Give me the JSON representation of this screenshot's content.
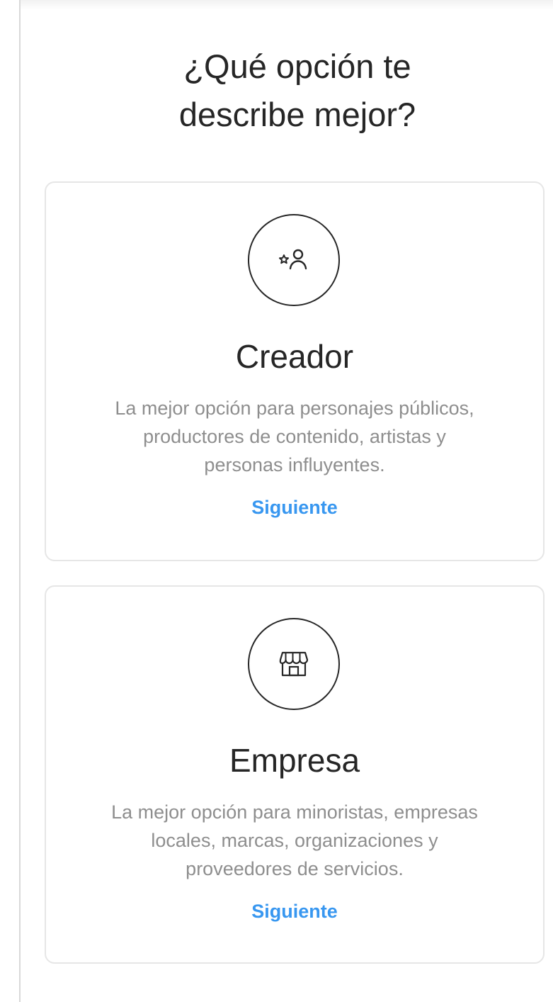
{
  "page": {
    "title": "¿Qué opción te\ndescribe mejor?"
  },
  "options": [
    {
      "title": "Creador",
      "icon": "creator-star-person-icon",
      "desc_lines": [
        "La mejor opción para personajes públicos,",
        "productores de contenido, artistas y",
        "personas influyentes."
      ],
      "next_label": "Siguiente"
    },
    {
      "title": "Empresa",
      "icon": "storefront-icon",
      "desc_lines": [
        "La mejor opción para minoristas, empresas",
        "locales, marcas, organizaciones y",
        "proveedores de servicios."
      ],
      "next_label": "Siguiente"
    }
  ],
  "colors": {
    "text_primary": "#262626",
    "text_secondary": "#8e8e8e",
    "link_blue": "#3897f0",
    "card_border": "#e6e6e6"
  }
}
